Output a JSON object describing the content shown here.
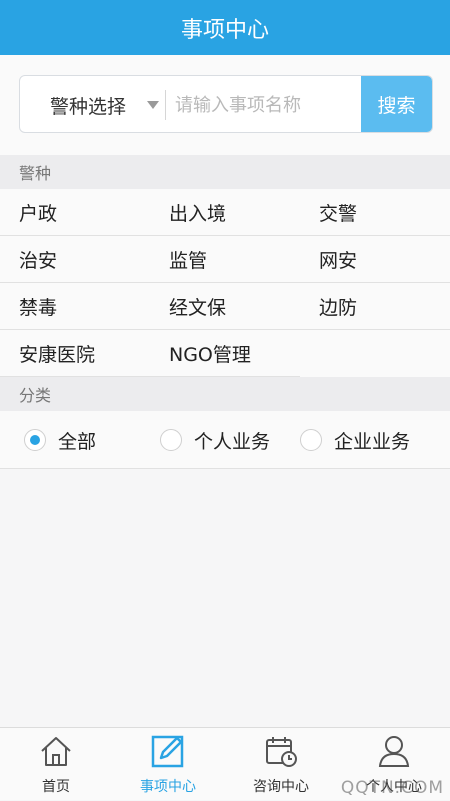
{
  "header": {
    "title": "事项中心"
  },
  "search": {
    "select_label": "警种选择",
    "placeholder": "请输入事项名称",
    "button_label": "搜索"
  },
  "police_section": {
    "title": "警种",
    "items": [
      "户政",
      "出入境",
      "交警",
      "治安",
      "监管",
      "网安",
      "禁毒",
      "经文保",
      "边防",
      "安康医院",
      "NGO管理"
    ]
  },
  "category_section": {
    "title": "分类",
    "options": [
      {
        "label": "全部",
        "checked": true
      },
      {
        "label": "个人业务",
        "checked": false
      },
      {
        "label": "企业业务",
        "checked": false
      }
    ]
  },
  "tabbar": {
    "tabs": [
      {
        "label": "首页",
        "icon": "home-icon",
        "active": false
      },
      {
        "label": "事项中心",
        "icon": "edit-icon",
        "active": true
      },
      {
        "label": "咨询中心",
        "icon": "calendar-clock-icon",
        "active": false
      },
      {
        "label": "个人中心",
        "icon": "user-icon",
        "active": false
      }
    ]
  },
  "watermark": "QQTN.COM",
  "colors": {
    "accent": "#29a3e3",
    "search_button": "#5bbcf0"
  }
}
